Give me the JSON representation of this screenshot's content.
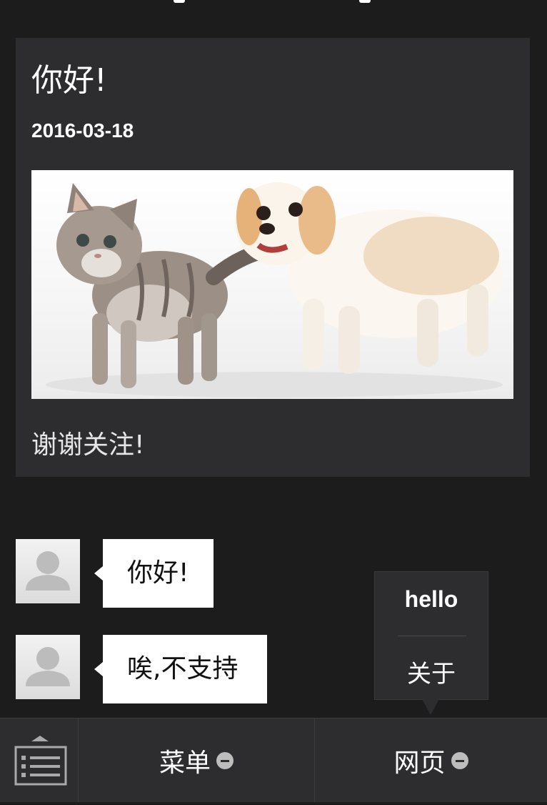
{
  "article": {
    "title": "你好!",
    "date": "2016-03-18",
    "image_icon": "kitten-and-puppy-photo",
    "footer": "谢谢关注!"
  },
  "messages": [
    {
      "avatar_icon": "default-user-avatar-icon",
      "text": "你好!"
    },
    {
      "avatar_icon": "default-user-avatar-icon",
      "text": "唉,不支持"
    }
  ],
  "popup_menu": {
    "items": [
      "hello",
      "关于"
    ]
  },
  "bottom_bar": {
    "keyboard_icon": "keyboard-toggle-icon",
    "tabs": [
      {
        "label": "菜单",
        "icon": "collapse-circle-icon"
      },
      {
        "label": "网页",
        "icon": "collapse-circle-icon"
      }
    ]
  },
  "colors": {
    "background": "#1c1c1d",
    "panel": "#2d2d30",
    "bubble": "#ffffff"
  }
}
